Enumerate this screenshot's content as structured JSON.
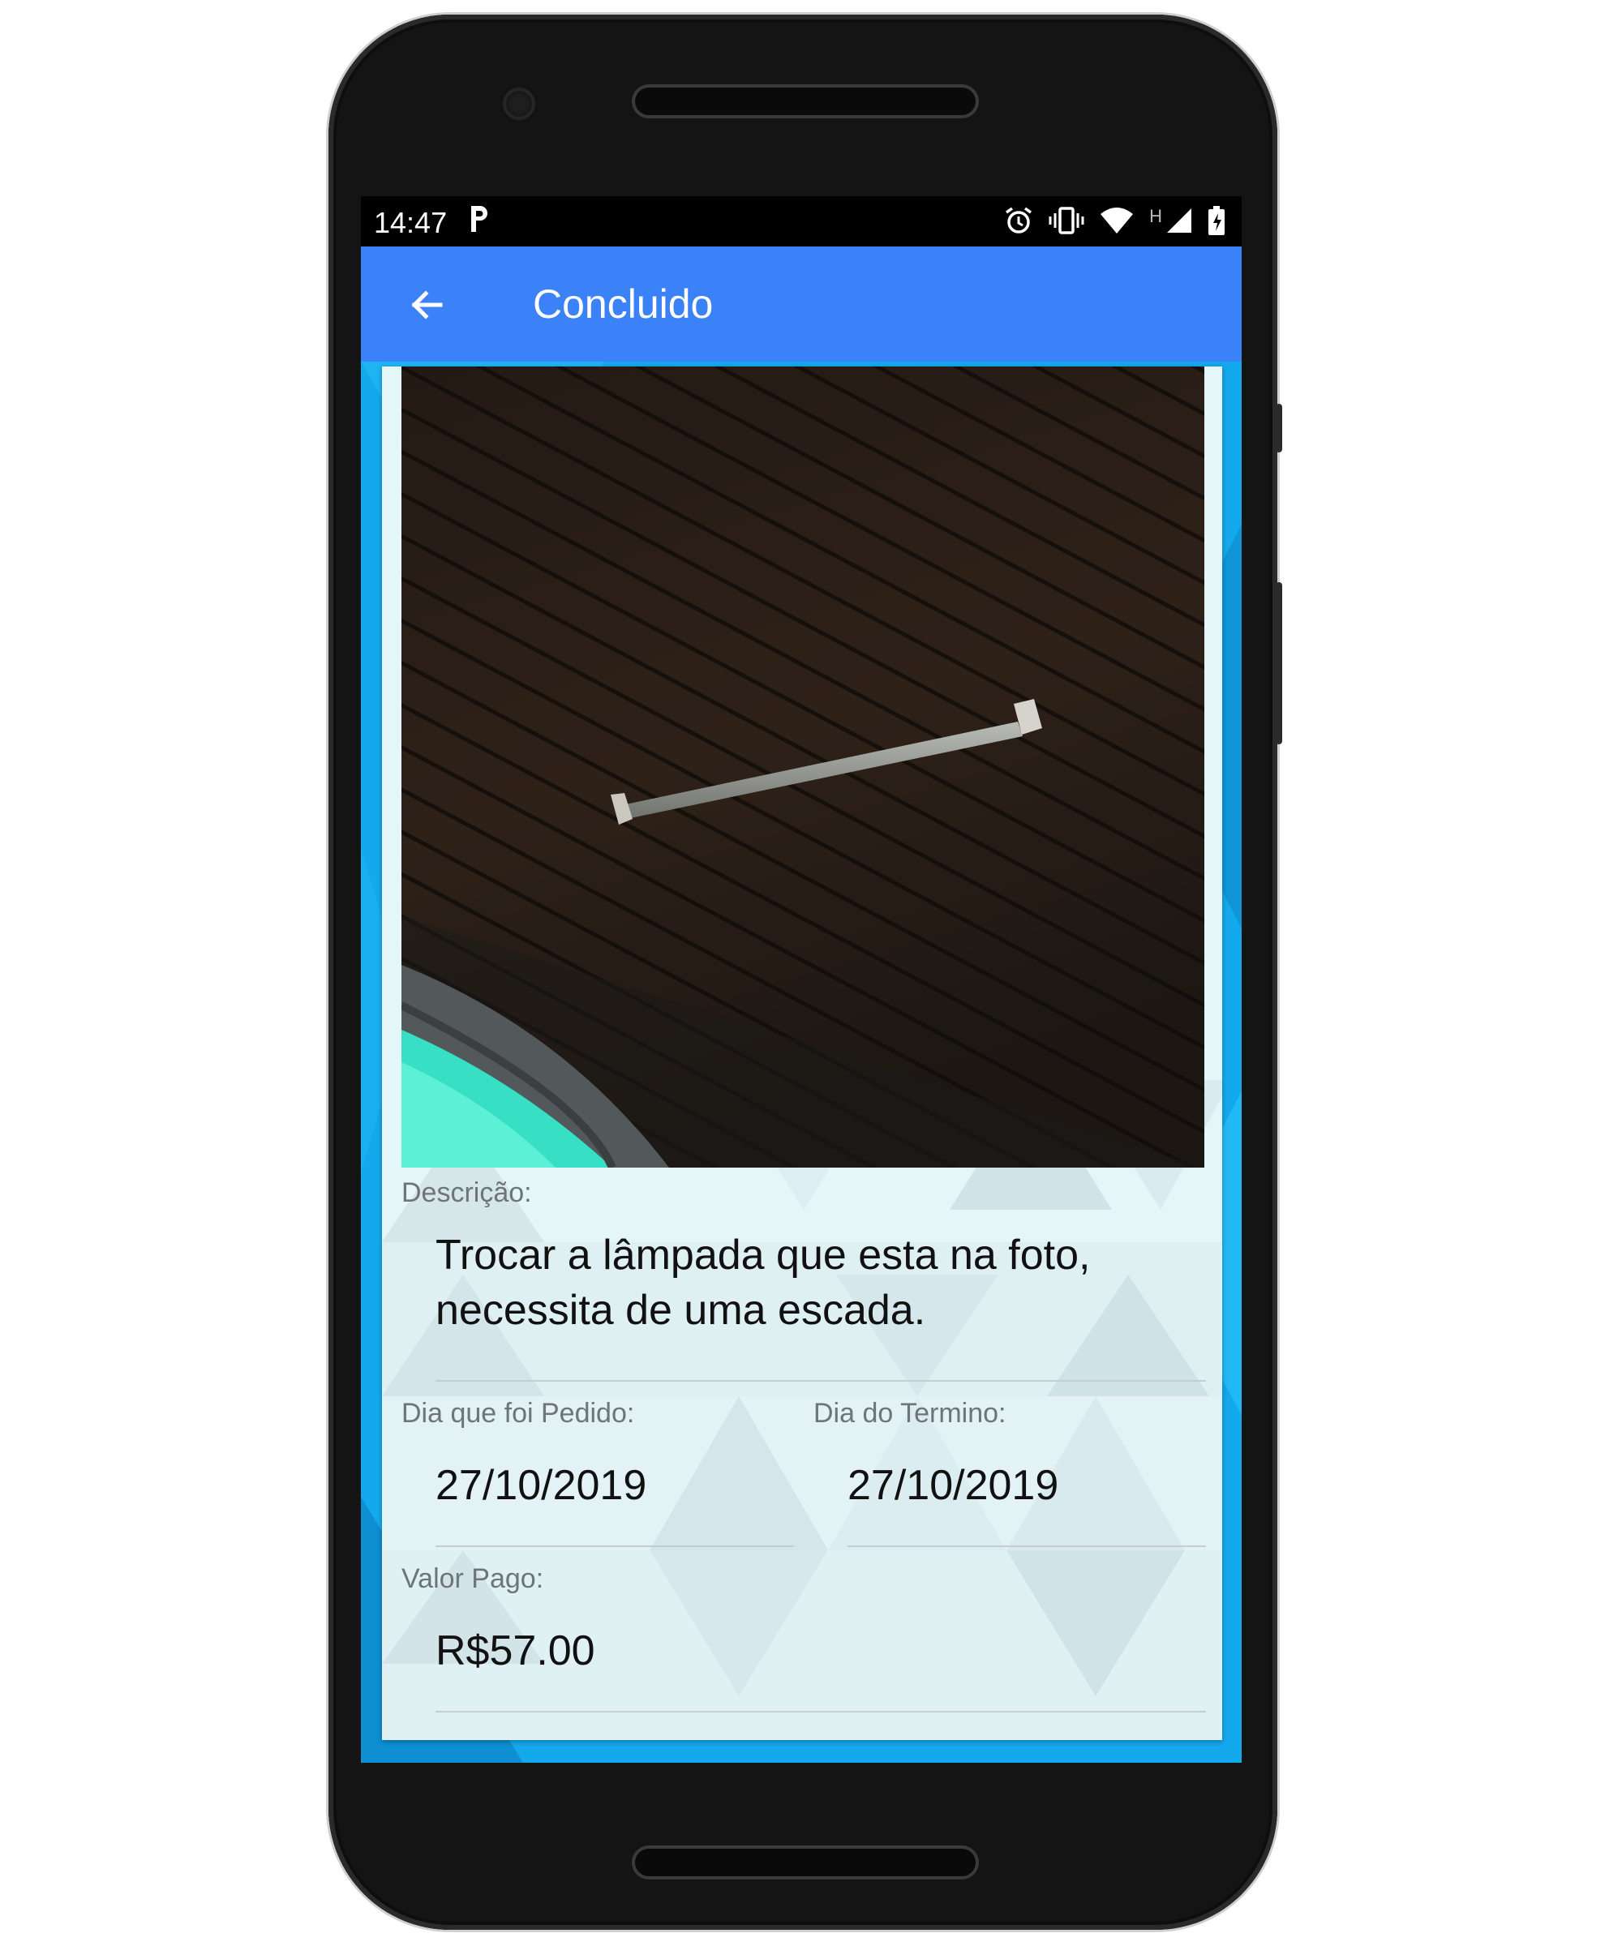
{
  "status_bar": {
    "time": "14:47",
    "notification_icon": "parking-p-icon",
    "icons": [
      "alarm-icon",
      "vibrate-icon",
      "wifi-icon",
      "h-network-icon",
      "signal-icon",
      "battery-charging-icon"
    ],
    "network_type": "H"
  },
  "app_bar": {
    "title": "Concluido",
    "back_icon": "arrow-left-icon",
    "color": "#3b81f7"
  },
  "detail": {
    "photo_description": "photo-of-fluorescent-tube-lamp-on-wooden-ceiling",
    "description_label": "Descrição:",
    "description_value": "Trocar a lâmpada que esta na foto, necessita de uma escada.",
    "request_date_label": "Dia que foi Pedido:",
    "request_date_value": "27/10/2019",
    "end_date_label": "Dia do Termino:",
    "end_date_value": "27/10/2019",
    "paid_label": "Valor Pago:",
    "paid_value": "R$57.00"
  }
}
